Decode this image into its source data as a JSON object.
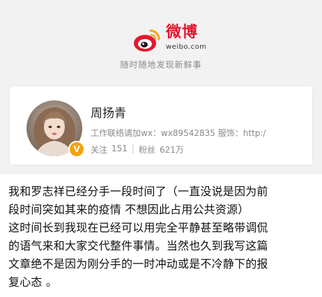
{
  "brand": {
    "name_cn": "微博",
    "name_en": "weibo.com",
    "tagline": "随时随地发现新鲜事",
    "accent_color": "#e6162d"
  },
  "profile": {
    "username": "周扬青",
    "bio": "工作联络请加wx：wx89542835 服饰：http:/",
    "following_label": "关注",
    "following_count": "151",
    "followers_label": "粉丝",
    "followers_count": "621万",
    "verified_badge": "V",
    "verified_color": "#f2a20c",
    "avatar_icon": "user-avatar-photo"
  },
  "post": {
    "lines": [
      "我和罗志祥已经分手一段时间了（一直没说是因为前",
      "段时间突如其来的疫情 不想因此占用公共资源）",
      "这时间长到我现在已经可以用完全平静甚至略带调侃",
      "的语气来和大家交代整件事情。当然也久到我写这篇",
      "文章绝不是因为刚分手的一时冲动或是不冷静下的报",
      "复心态 。"
    ]
  }
}
